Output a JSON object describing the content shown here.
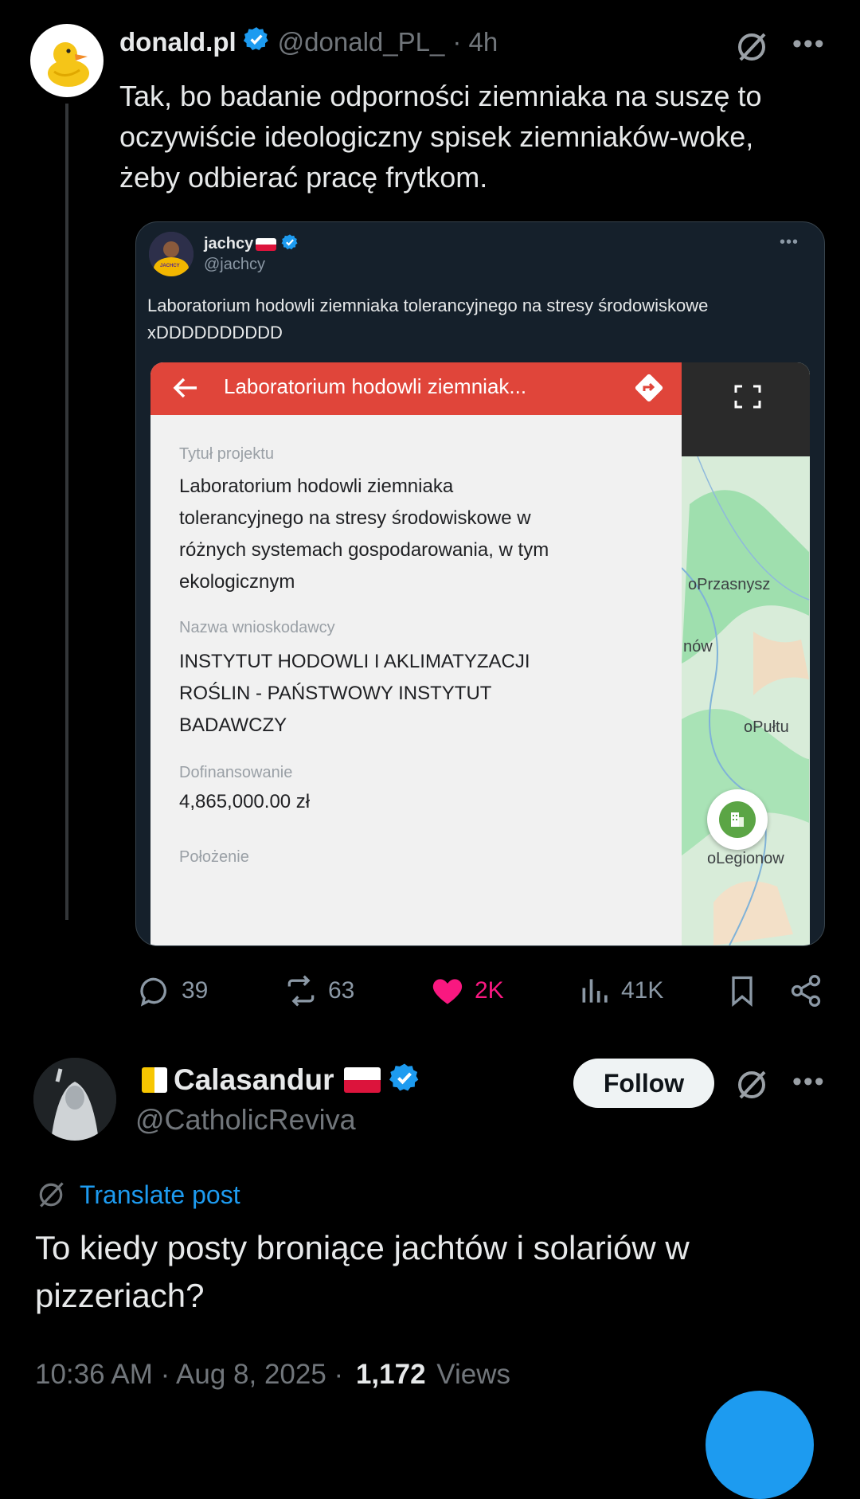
{
  "parent_post": {
    "display_name": "donald.pl",
    "handle": "@donald_PL_",
    "time": "· 4h",
    "text": "Tak, bo badanie odporności ziemniaka na suszę to oczywiście ideologiczny spisek ziemniaków-woke, żeby odbierać pracę frytkom.",
    "embedded": {
      "display_name": "jachcy",
      "handle": "@jachcy",
      "avatar_text": "JACHCY",
      "text": "Laboratorium hodowli ziemniaka tolerancyjnego na stresy środowiskowe xDDDDDDDDDD",
      "screenshot": {
        "header_title": "Laboratorium hodowli ziemniak...",
        "fields": [
          {
            "label": "Tytuł projektu",
            "value": "Laboratorium hodowli ziemniaka tolerancyjnego na stresy środowiskowe w różnych systemach gospodarowania, w tym ekologicznym"
          },
          {
            "label": "Nazwa wnioskodawcy",
            "value": "INSTYTUT HODOWLI I AKLIMATYZACJI ROŚLIN - PAŃSTWOWY INSTYTUT BADAWCZY"
          },
          {
            "label": "Dofinansowanie",
            "value": "4,865,000.00 zł"
          },
          {
            "label": "Położenie",
            "value": ""
          }
        ],
        "map_labels": [
          "oPrzasnysz",
          "nów",
          "oPułtu",
          "oLegionow"
        ]
      }
    },
    "actions": {
      "replies": "39",
      "reposts": "63",
      "likes": "2K",
      "views": "41K"
    }
  },
  "reply_post": {
    "display_name": "Calasandur",
    "handle": "@CatholicReviva",
    "follow_label": "Follow",
    "translate_label": "Translate post",
    "text": "To kiedy posty broniące jachtów i solariów w pizzeriach?",
    "time": "10:36 AM · Aug 8, 2025 ·",
    "views_count": "1,172",
    "views_label": "Views"
  },
  "colors": {
    "verified": "#1d9bf0",
    "like": "#f91880",
    "link": "#1d9bf0",
    "muted": "#71767b",
    "screenshot_header": "#e0453a"
  }
}
